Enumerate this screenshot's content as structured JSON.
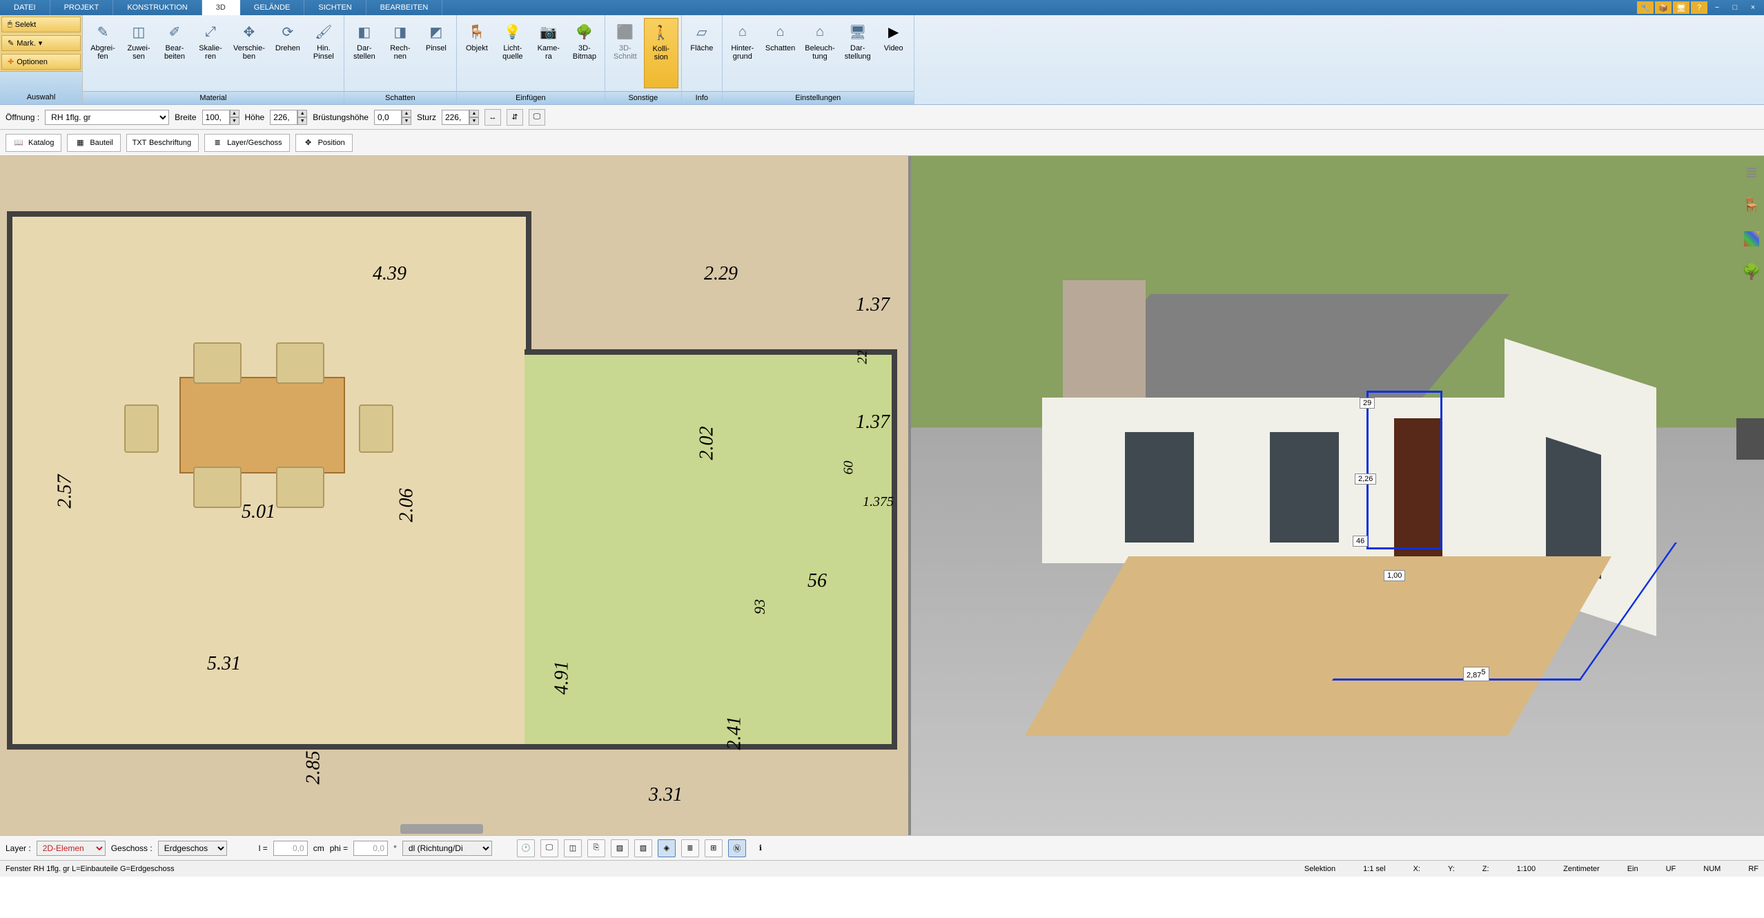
{
  "menu": {
    "tabs": [
      "DATEI",
      "PROJEKT",
      "KONSTRUKTION",
      "3D",
      "GELÄNDE",
      "SICHTEN",
      "BEARBEITEN"
    ],
    "active_index": 3
  },
  "selection_panel": {
    "select": "Selekt",
    "mark": "Mark.",
    "optionen": "Optionen",
    "label": "Auswahl"
  },
  "ribbon_groups": [
    {
      "label": "Material",
      "items": [
        {
          "label": "Abgrei-\nfen",
          "icon": "eyedropper-icon"
        },
        {
          "label": "Zuwei-\nsen",
          "icon": "apply-icon"
        },
        {
          "label": "Bear-\nbeiten",
          "icon": "edit-icon"
        },
        {
          "label": "Skalie-\nren",
          "icon": "scale-icon"
        },
        {
          "label": "Verschie-\nben",
          "icon": "move-icon"
        },
        {
          "label": "Drehen",
          "icon": "rotate-icon"
        },
        {
          "label": "Hin.\nPinsel",
          "icon": "brush-icon"
        }
      ]
    },
    {
      "label": "Schatten",
      "items": [
        {
          "label": "Dar-\nstellen",
          "icon": "cube-icon"
        },
        {
          "label": "Rech-\nnen",
          "icon": "calc-icon"
        },
        {
          "label": "Pinsel",
          "icon": "paint-icon"
        }
      ]
    },
    {
      "label": "Einfügen",
      "items": [
        {
          "label": "Objekt",
          "icon": "chair-icon"
        },
        {
          "label": "Licht-\nquelle",
          "icon": "bulb-icon"
        },
        {
          "label": "Kame-\nra",
          "icon": "camera-icon"
        },
        {
          "label": "3D-\nBitmap",
          "icon": "tree-icon"
        }
      ]
    },
    {
      "label": "Sonstige",
      "items": [
        {
          "label": "3D-\nSchnitt",
          "icon": "section-icon"
        },
        {
          "label": "Kolli-\nsion",
          "icon": "collision-icon",
          "active": true
        }
      ]
    },
    {
      "label": "Info",
      "items": [
        {
          "label": "Fläche",
          "icon": "area-icon"
        }
      ]
    },
    {
      "label": "Einstellungen",
      "items": [
        {
          "label": "Hinter-\ngrund",
          "icon": "background-icon"
        },
        {
          "label": "Schatten",
          "icon": "shadow-icon"
        },
        {
          "label": "Beleuch-\ntung",
          "icon": "lighting-icon"
        },
        {
          "label": "Dar-\nstellung",
          "icon": "display-icon"
        },
        {
          "label": "Video",
          "icon": "play-icon"
        }
      ]
    }
  ],
  "props": {
    "oeffnung_label": "Öffnung :",
    "oeffnung_value": "RH 1flg. gr",
    "breite_label": "Breite",
    "breite_value": "100,",
    "hoehe_label": "Höhe",
    "hoehe_value": "226,",
    "bruest_label": "Brüstungshöhe",
    "bruest_value": "0,0",
    "sturz_label": "Sturz",
    "sturz_value": "226,"
  },
  "toolbar2": {
    "katalog": "Katalog",
    "bauteil": "Bauteil",
    "beschriftung": "Beschriftung",
    "layer": "Layer/Geschoss",
    "position": "Position"
  },
  "plan_dims": {
    "d1": "4.39",
    "d2": "2.29",
    "d3": "5.01",
    "d4": "2.57",
    "d5": "2.06",
    "d6": "5.31",
    "d7": "2.85",
    "d8": "3.31",
    "d9": "2.41",
    "d10": "4.91",
    "d11": "2.02",
    "d12": "1.37",
    "d13": "56",
    "d14": "93",
    "d15": "1.37",
    "d16": "22",
    "d17": "60",
    "d18": "1.375"
  },
  "measurements_3d": {
    "m1": "29",
    "m2": "2,26",
    "m3": "46",
    "m4": "1,00",
    "m5": "2,87"
  },
  "bottom": {
    "layer_label": "Layer :",
    "layer_value": "2D-Elemen",
    "geschoss_label": "Geschoss :",
    "geschoss_value": "Erdgeschos",
    "l_label": "l =",
    "l_value": "0,0",
    "l_unit": "cm",
    "phi_label": "phi =",
    "phi_value": "0,0",
    "phi_unit": "°",
    "dl_value": "dl (Richtung/Di"
  },
  "status": {
    "left": "Fenster RH 1flg. gr L=Einbauteile G=Erdgeschoss",
    "selektion": "Selektion",
    "sel_count": "1:1 sel",
    "x": "X:",
    "y": "Y:",
    "z": "Z:",
    "scale": "1:100",
    "unit": "Zentimeter",
    "ein": "Ein",
    "uf": "UF",
    "num": "NUM",
    "rf": "RF"
  }
}
